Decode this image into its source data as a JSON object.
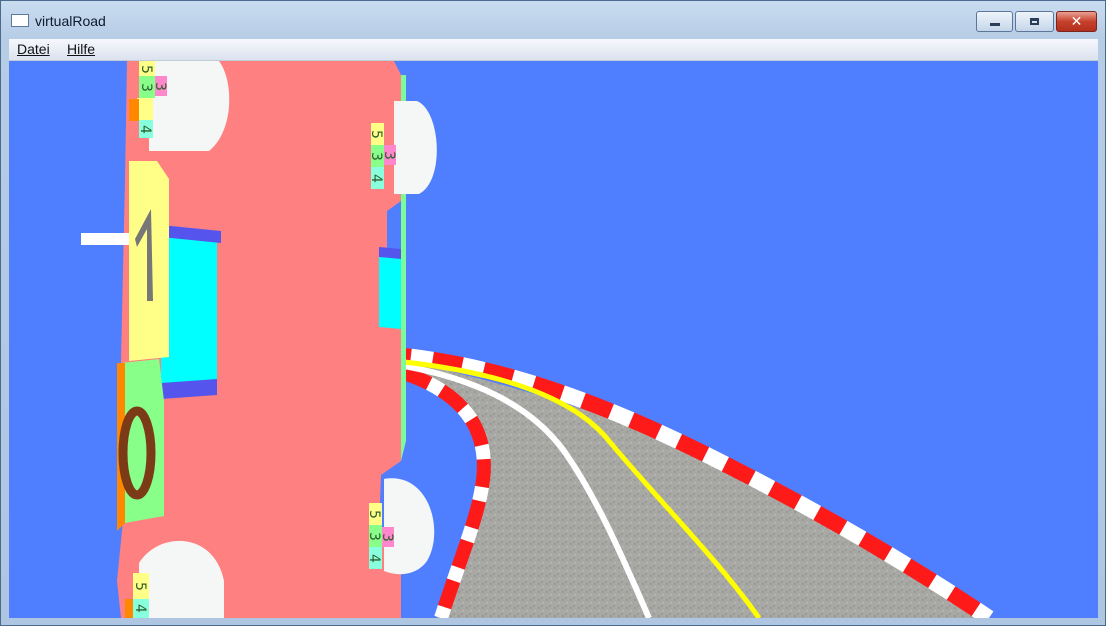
{
  "window": {
    "title": "virtualRoad",
    "icon": "app-window-icon",
    "controls": [
      "minimize-icon",
      "maximize-icon",
      "close-icon"
    ]
  },
  "menu": {
    "items": [
      {
        "label": "Datei"
      },
      {
        "label": "Hilfe"
      }
    ]
  },
  "scene": {
    "sky_color": "#4f7fff",
    "car_body_color": "#ff8080",
    "road_color": "#a7a7a3",
    "center_line_color": "#ffff00",
    "kerb_colors": [
      "#ff1a1a",
      "#ffffff"
    ],
    "car_labels": {
      "front_left": [
        "5",
        "3",
        "4",
        "3"
      ],
      "front_right": [
        "5",
        "3",
        "4",
        "3"
      ],
      "rear_right": [
        "5",
        "3",
        "4",
        "3"
      ],
      "rear_left": [
        "5",
        "4"
      ],
      "seat_number_1": "1",
      "seat_number_2": "0"
    }
  }
}
